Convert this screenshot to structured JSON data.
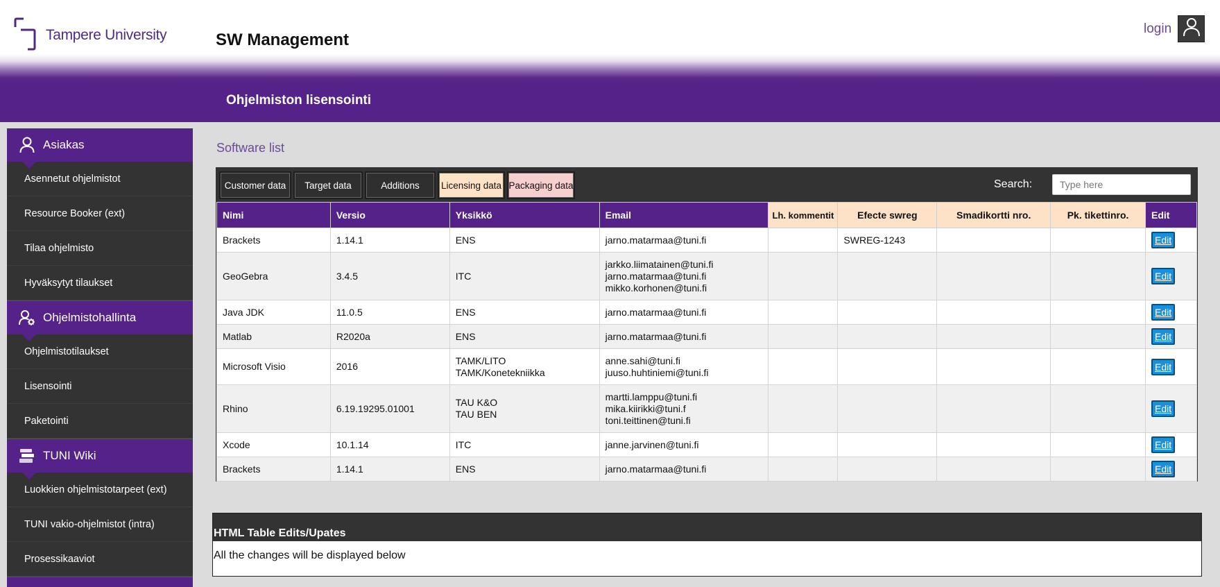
{
  "header": {
    "logo_text": "Tampere University",
    "app_title": "SW Management",
    "login_label": "login",
    "section_title": "Ohjelmiston lisensointi"
  },
  "sidebar": {
    "groups": [
      {
        "title": "Asiakas",
        "icon": "person-icon",
        "items": [
          "Asennetut ohjelmistot",
          "Resource Booker (ext)",
          "Tilaa ohjelmisto",
          "Hyväksytyt tilaukset"
        ]
      },
      {
        "title": "Ohjelmistohallinta",
        "icon": "user-gear-icon",
        "items": [
          "Ohjelmistotilaukset",
          "Lisensointi",
          "Paketointi"
        ]
      },
      {
        "title": "TUNI Wiki",
        "icon": "books-icon",
        "items": [
          "Luokkien ohjelmistotarpeet (ext)",
          "TUNI vakio-ohjelmistot (intra)",
          "Prosessikaaviot"
        ]
      }
    ]
  },
  "main": {
    "list_title": "Software list",
    "tabs": [
      "Customer data",
      "Target data",
      "Additions",
      "Licensing data",
      "Packaging data"
    ],
    "search_label": "Search:",
    "search_placeholder": "Type here",
    "columns": [
      "Nimi",
      "Versio",
      "Yksikkö",
      "Email",
      "Lh. kommentit",
      "Efecte swreg",
      "Smadikortti nro.",
      "Pk. tikettinro.",
      "Edit"
    ],
    "rows": [
      {
        "name": "Brackets",
        "version": "1.14.1",
        "unit": [
          "ENS"
        ],
        "email": [
          "jarno.matarmaa@tuni.fi"
        ],
        "lh": "",
        "efecte": "SWREG-1243",
        "smadi": "",
        "pk": "",
        "edit": "Edit"
      },
      {
        "name": "GeoGebra",
        "version": "3.4.5",
        "unit": [
          "ITC"
        ],
        "email": [
          "jarkko.liimatainen@tuni.fi",
          "jarno.matarmaa@tuni.fi",
          "mikko.korhonen@tuni.fi"
        ],
        "lh": "",
        "efecte": "",
        "smadi": "",
        "pk": "",
        "edit": "Edit"
      },
      {
        "name": "Java JDK",
        "version": "11.0.5",
        "unit": [
          "ENS"
        ],
        "email": [
          "jarno.matarmaa@tuni.fi"
        ],
        "lh": "",
        "efecte": "",
        "smadi": "",
        "pk": "",
        "edit": "Edit"
      },
      {
        "name": "Matlab",
        "version": "R2020a",
        "unit": [
          "ENS"
        ],
        "email": [
          "jarno.matarmaa@tuni.fi"
        ],
        "lh": "",
        "efecte": "",
        "smadi": "",
        "pk": "",
        "edit": "Edit"
      },
      {
        "name": "Microsoft Visio",
        "version": "2016",
        "unit": [
          "TAMK/LITO",
          "TAMK/Konetekniikka"
        ],
        "email": [
          "anne.sahi@tuni.fi",
          "juuso.huhtiniemi@tuni.fi"
        ],
        "lh": "",
        "efecte": "",
        "smadi": "",
        "pk": "",
        "edit": "Edit"
      },
      {
        "name": "Rhino",
        "version": "6.19.19295.01001",
        "unit": [
          "TAU K&O",
          "TAU BEN"
        ],
        "email": [
          "martti.lamppu@tuni.fi",
          "mika.kiirikki@tuni.f",
          "toni.teittinen@tuni.fi"
        ],
        "lh": "",
        "efecte": "",
        "smadi": "",
        "pk": "",
        "edit": "Edit"
      },
      {
        "name": "Xcode",
        "version": "10.1.14",
        "unit": [
          "ITC"
        ],
        "email": [
          "janne.jarvinen@tuni.fi"
        ],
        "lh": "",
        "efecte": "",
        "smadi": "",
        "pk": "",
        "edit": "Edit"
      },
      {
        "name": "Brackets",
        "version": "1.14.1",
        "unit": [
          "ENS"
        ],
        "email": [
          "jarno.matarmaa@tuni.fi"
        ],
        "lh": "",
        "efecte": "",
        "smadi": "",
        "pk": "",
        "edit": "Edit"
      }
    ]
  },
  "edits": {
    "title": "HTML Table Edits/Upates",
    "message": "All the changes will be displayed below"
  },
  "colors": {
    "brand_purple": "#55228a",
    "dark_panel": "#333333",
    "licensing_tab": "#fde2c7",
    "packaging_tab": "#f8cfcf",
    "edit_button": "#1a8fdc"
  }
}
